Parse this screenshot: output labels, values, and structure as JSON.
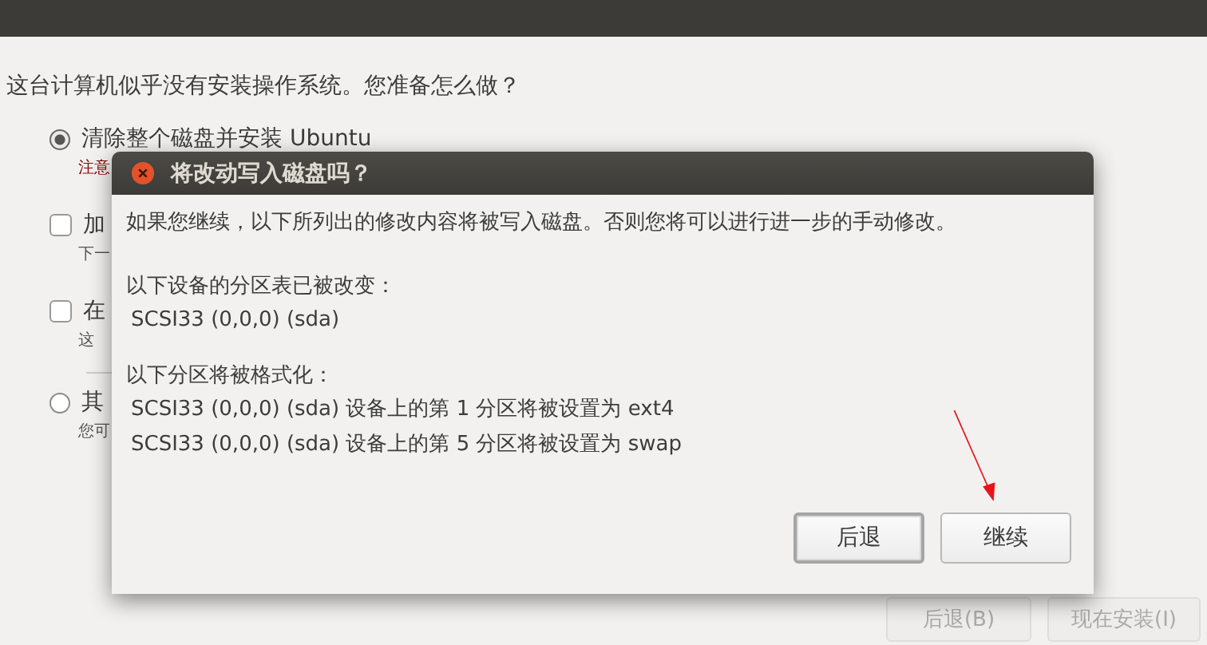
{
  "background": {
    "question": "这台计算机似乎没有安装操作系统。您准备怎么做？",
    "options": [
      {
        "kind": "radio",
        "selected": true,
        "label": "清除整个磁盘并安装 Ubuntu",
        "note": "注意",
        "warn": true
      },
      {
        "kind": "checkbox",
        "checked": false,
        "label": "加",
        "note": "下一",
        "warn": false
      },
      {
        "kind": "checkbox",
        "checked": false,
        "label": "在",
        "note": "这",
        "warn": false
      },
      {
        "kind": "radio",
        "selected": false,
        "label": "其",
        "note": "您可",
        "warn": false
      }
    ],
    "buttons": [
      {
        "label": "后退(B)",
        "disabled": true
      },
      {
        "label": "现在安装(I)",
        "disabled": true
      }
    ]
  },
  "dialog": {
    "title": "将改动写入磁盘吗？",
    "intro": "如果您继续，以下所列出的修改内容将被写入磁盘。否则您将可以进行进一步的手动修改。",
    "sections": [
      {
        "heading": "以下设备的分区表已被改变：",
        "lines": [
          "SCSI33 (0,0,0) (sda)"
        ]
      },
      {
        "heading": "以下分区将被格式化：",
        "lines": [
          "SCSI33 (0,0,0) (sda) 设备上的第 1 分区将被设置为 ext4",
          "SCSI33 (0,0,0) (sda) 设备上的第 5 分区将被设置为 swap"
        ]
      }
    ],
    "buttons": [
      {
        "label": "后退",
        "focused": true
      },
      {
        "label": "继续",
        "focused": false
      }
    ]
  }
}
